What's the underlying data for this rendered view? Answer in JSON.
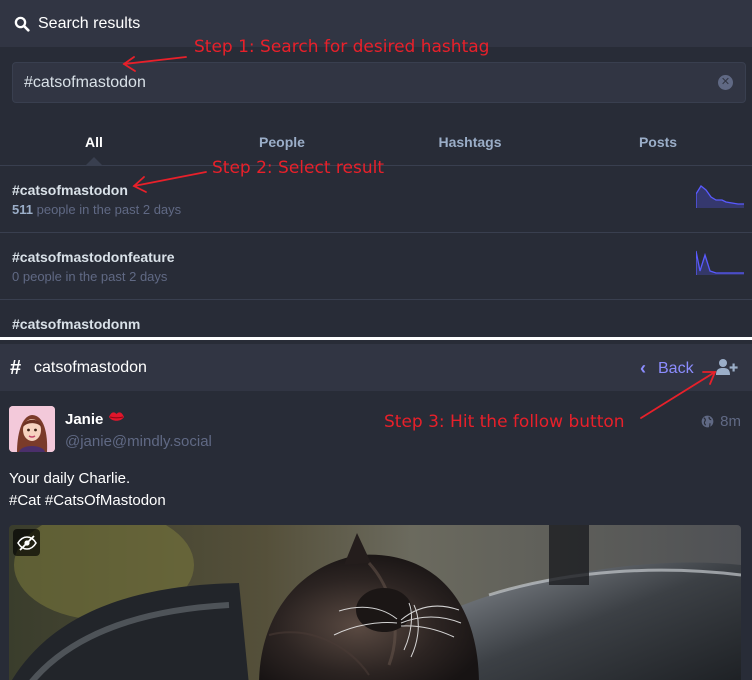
{
  "search_panel": {
    "title": "Search results",
    "query": "#catsofmastodon",
    "tabs": [
      {
        "label": "All",
        "active": true
      },
      {
        "label": "People",
        "active": false
      },
      {
        "label": "Hashtags",
        "active": false
      },
      {
        "label": "Posts",
        "active": false
      }
    ],
    "results": [
      {
        "tag": "#catsofmastodon",
        "count": "511",
        "meta_suffix": "people in the past 2 days"
      },
      {
        "tag": "#catsofmastodonfeature",
        "count": "0",
        "meta_suffix": "people in the past 2 days"
      },
      {
        "tag": "#catsofmastodonm",
        "count": "",
        "meta_suffix": ""
      }
    ]
  },
  "hashtag_panel": {
    "title": "catsofmastodon",
    "back_label": "Back",
    "status": {
      "display_name": "Janie",
      "handle": "@janie@mindly.social",
      "time": "8m",
      "content_lines": [
        "Your daily Charlie.",
        "#Cat #CatsOfMastodon"
      ]
    }
  },
  "annotations": {
    "step1": "Step 1: Search for desired hashtag",
    "step2": "Step 2: Select result",
    "step3": "Step 3: Hit the follow button"
  },
  "colors": {
    "background": "#282c37",
    "header": "#313543",
    "accent": "#8c8dff",
    "annotation": "#e8202a",
    "sparkline": "#595aff"
  },
  "icons": {
    "search": "search-icon",
    "clear": "clear-search-icon",
    "hashtag": "hashtag-icon",
    "back": "chevron-left-icon",
    "follow": "user-plus-icon",
    "visibility": "globe-icon",
    "hide_media": "eye-slash-icon",
    "emoji": "lips-emoji-icon"
  }
}
